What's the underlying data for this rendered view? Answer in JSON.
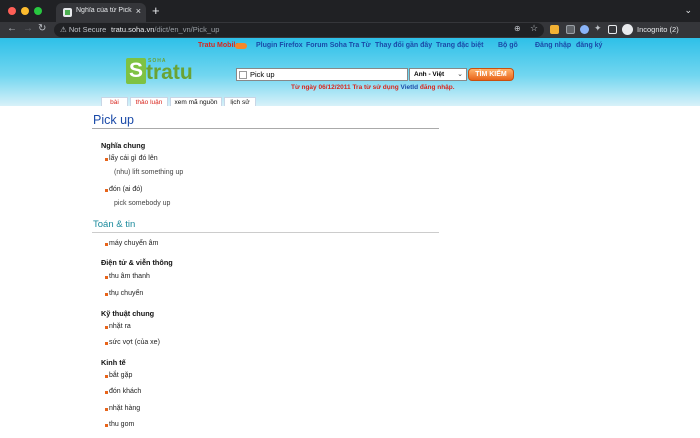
{
  "browser": {
    "tab_title": "Nghĩa của từ Pick up - Từ điển",
    "new_tab": "+",
    "security": "Not Secure",
    "url_host": "tratu.soha.vn",
    "url_path": "/dict/en_vn/Pick_up",
    "profile": "Incognito (2)"
  },
  "site": {
    "nav": {
      "mobile": "Tratu Mobile",
      "plugin": "Plugin Firefox",
      "forum": "Forum Soha Tra Từ",
      "change_skin": "Thay đổi gần đây",
      "special": "Trang đặc biệt",
      "typing": "Bộ gõ",
      "login": "Đăng nhập",
      "register": "đăng ký"
    },
    "logo_small": "SOHA",
    "logo_s": "S",
    "logo_text": "tratu",
    "search_value": "Pick up",
    "dict_option": "Anh - Việt",
    "search_button": "TÌM KIẾM",
    "notice_prefix": "Từ ngày 06/12/2011 Tra từ sử dụng ",
    "notice_link": "VietId",
    "notice_suffix": " đăng nhập.",
    "tabs": [
      "bài",
      "thảo luận",
      "xem mã nguồn",
      "lịch sử"
    ]
  },
  "entry": {
    "headword": "Pick up",
    "general_heading": "Nghĩa chung",
    "general": [
      {
        "meaning": "lấy cái gì đó lên",
        "example": "(nhu) lift something up"
      },
      {
        "meaning": "đón (ai đó)",
        "example": "pick somebody up"
      }
    ],
    "category_heading": "Toán & tin",
    "math": [
      "máy chuyển âm"
    ],
    "electronics_heading": "Điện tử & viễn thông",
    "electronics": [
      "thu âm thanh",
      "thụ chuyển"
    ],
    "engineering_heading": "Kỹ thuật chung",
    "engineering": [
      "nhặt ra",
      "sức vợt (của xe)"
    ],
    "economics_heading": "Kinh tế",
    "economics": [
      "bắt gặp",
      "đón khách",
      "nhặt hàng",
      "thu gom"
    ]
  },
  "colors": {
    "banner": "#2ec0e8",
    "link_blue": "#1a4aa8",
    "red": "#d8261e",
    "category": "#1a8a9c",
    "search_button": "#e8641a"
  }
}
